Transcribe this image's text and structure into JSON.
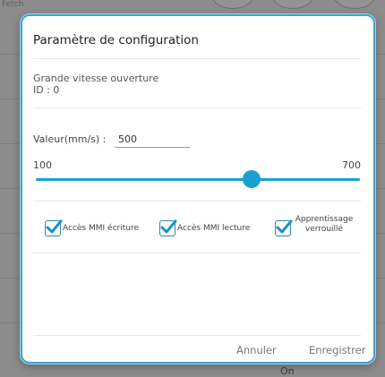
{
  "background": {
    "top_label": "Fetch",
    "status_text": "On"
  },
  "dialog": {
    "title": "Paramètre de configuration",
    "info": {
      "name": "Grande vitesse ouverture",
      "id_text": "ID : 0"
    },
    "value": {
      "label": "Valeur(mm/s) :",
      "current": "500"
    },
    "slider": {
      "min_label": "100",
      "max_label": "700",
      "min": 100,
      "max": 700,
      "value": 500
    },
    "checkboxes": [
      {
        "label": "Accès MMI écriture",
        "checked": true
      },
      {
        "label": "Accès MMI lecture",
        "checked": true
      },
      {
        "label": "Apprentissage verrouillé",
        "checked": true
      }
    ],
    "buttons": {
      "cancel": "Annuler",
      "save": "Enregistrer"
    },
    "colors": {
      "accent": "#1a9fd0",
      "border": "#3ca3cc"
    }
  }
}
